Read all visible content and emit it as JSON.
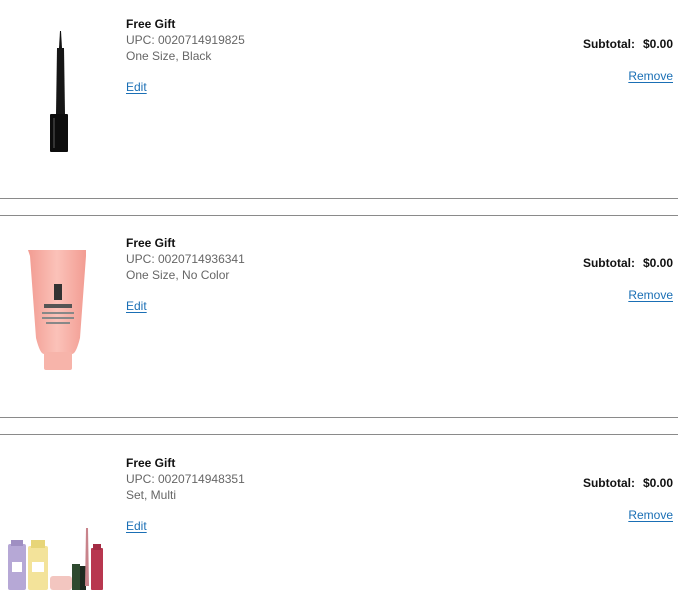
{
  "items": [
    {
      "image_icon": "eyeliner-pen",
      "title": "Free Gift",
      "upc": "UPC: 0020714919825",
      "variant": "One Size, Black",
      "edit_label": "Edit",
      "subtotal_label": "Subtotal:",
      "subtotal_value": "$0.00",
      "remove_label": "Remove"
    },
    {
      "image_icon": "pink-tube",
      "title": "Free Gift",
      "upc": "UPC: 0020714936341",
      "variant": "One Size, No Color",
      "edit_label": "Edit",
      "subtotal_label": "Subtotal:",
      "subtotal_value": "$0.00",
      "remove_label": "Remove",
      "brand_text": "CLINIQUE moisture surge hydrating supercharged concentrate"
    },
    {
      "image_icon": "gift-set",
      "title": "Free Gift",
      "upc": "UPC: 0020714948351",
      "variant": "Set, Multi",
      "edit_label": "Edit",
      "subtotal_label": "Subtotal:",
      "subtotal_value": "$0.00",
      "remove_label": "Remove"
    }
  ],
  "colors": {
    "link": "#1a6fb5",
    "divider": "#8a8a8a",
    "muted_text": "#666666"
  }
}
